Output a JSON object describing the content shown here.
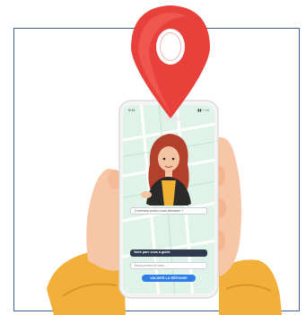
{
  "phone": {
    "status_time": "9:41",
    "status_icons": "▮▮ ◔ ▭",
    "bubble_question": "Comment voulez-vous démarrer ?",
    "bubble_selected": "Votre parc vous a guidé",
    "bubble_option": "Nous prenez-le vous ...",
    "validate_label": "VALIDER LA RÉPONSE"
  },
  "colors": {
    "pin": "#e8403a",
    "frame_border": "#3d5f9a",
    "sleeve": "#f2b03a",
    "skin": "#f7c6a6",
    "map": "#dff3e8",
    "button": "#2f7ee8"
  }
}
